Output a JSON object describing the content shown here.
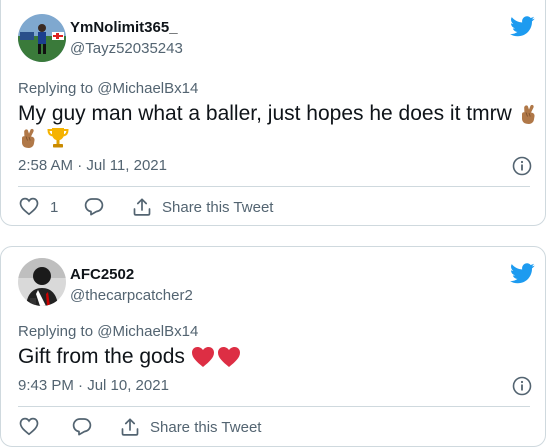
{
  "colors": {
    "twitter_blue": "#1d9bf0",
    "secondary_text": "#536471",
    "heart_red": "#e0245e",
    "skin_tone": "#b07848",
    "trophy_gold": "#f5b301"
  },
  "tweets": [
    {
      "display_name": "YmNolimit365_",
      "handle": "@Tayz52035243",
      "replying_prefix": "Replying to",
      "replying_to": "@MichaelBx14",
      "text": "My guy man what a baller, just hopes he does it tmrw",
      "emojis": [
        "crossed-fingers",
        "crossed-fingers",
        "trophy"
      ],
      "timestamp": "2:58 AM · Jul 11, 2021",
      "like_count": "1",
      "share_label": "Share this Tweet"
    },
    {
      "display_name": "AFC2502",
      "handle": "@thecarpcatcher2",
      "replying_prefix": "Replying to",
      "replying_to": "@MichaelBx14",
      "text": "Gift from the gods",
      "emojis": [
        "red-heart",
        "red-heart"
      ],
      "timestamp": "9:43 PM · Jul 10, 2021",
      "like_count": "",
      "share_label": "Share this Tweet"
    }
  ]
}
